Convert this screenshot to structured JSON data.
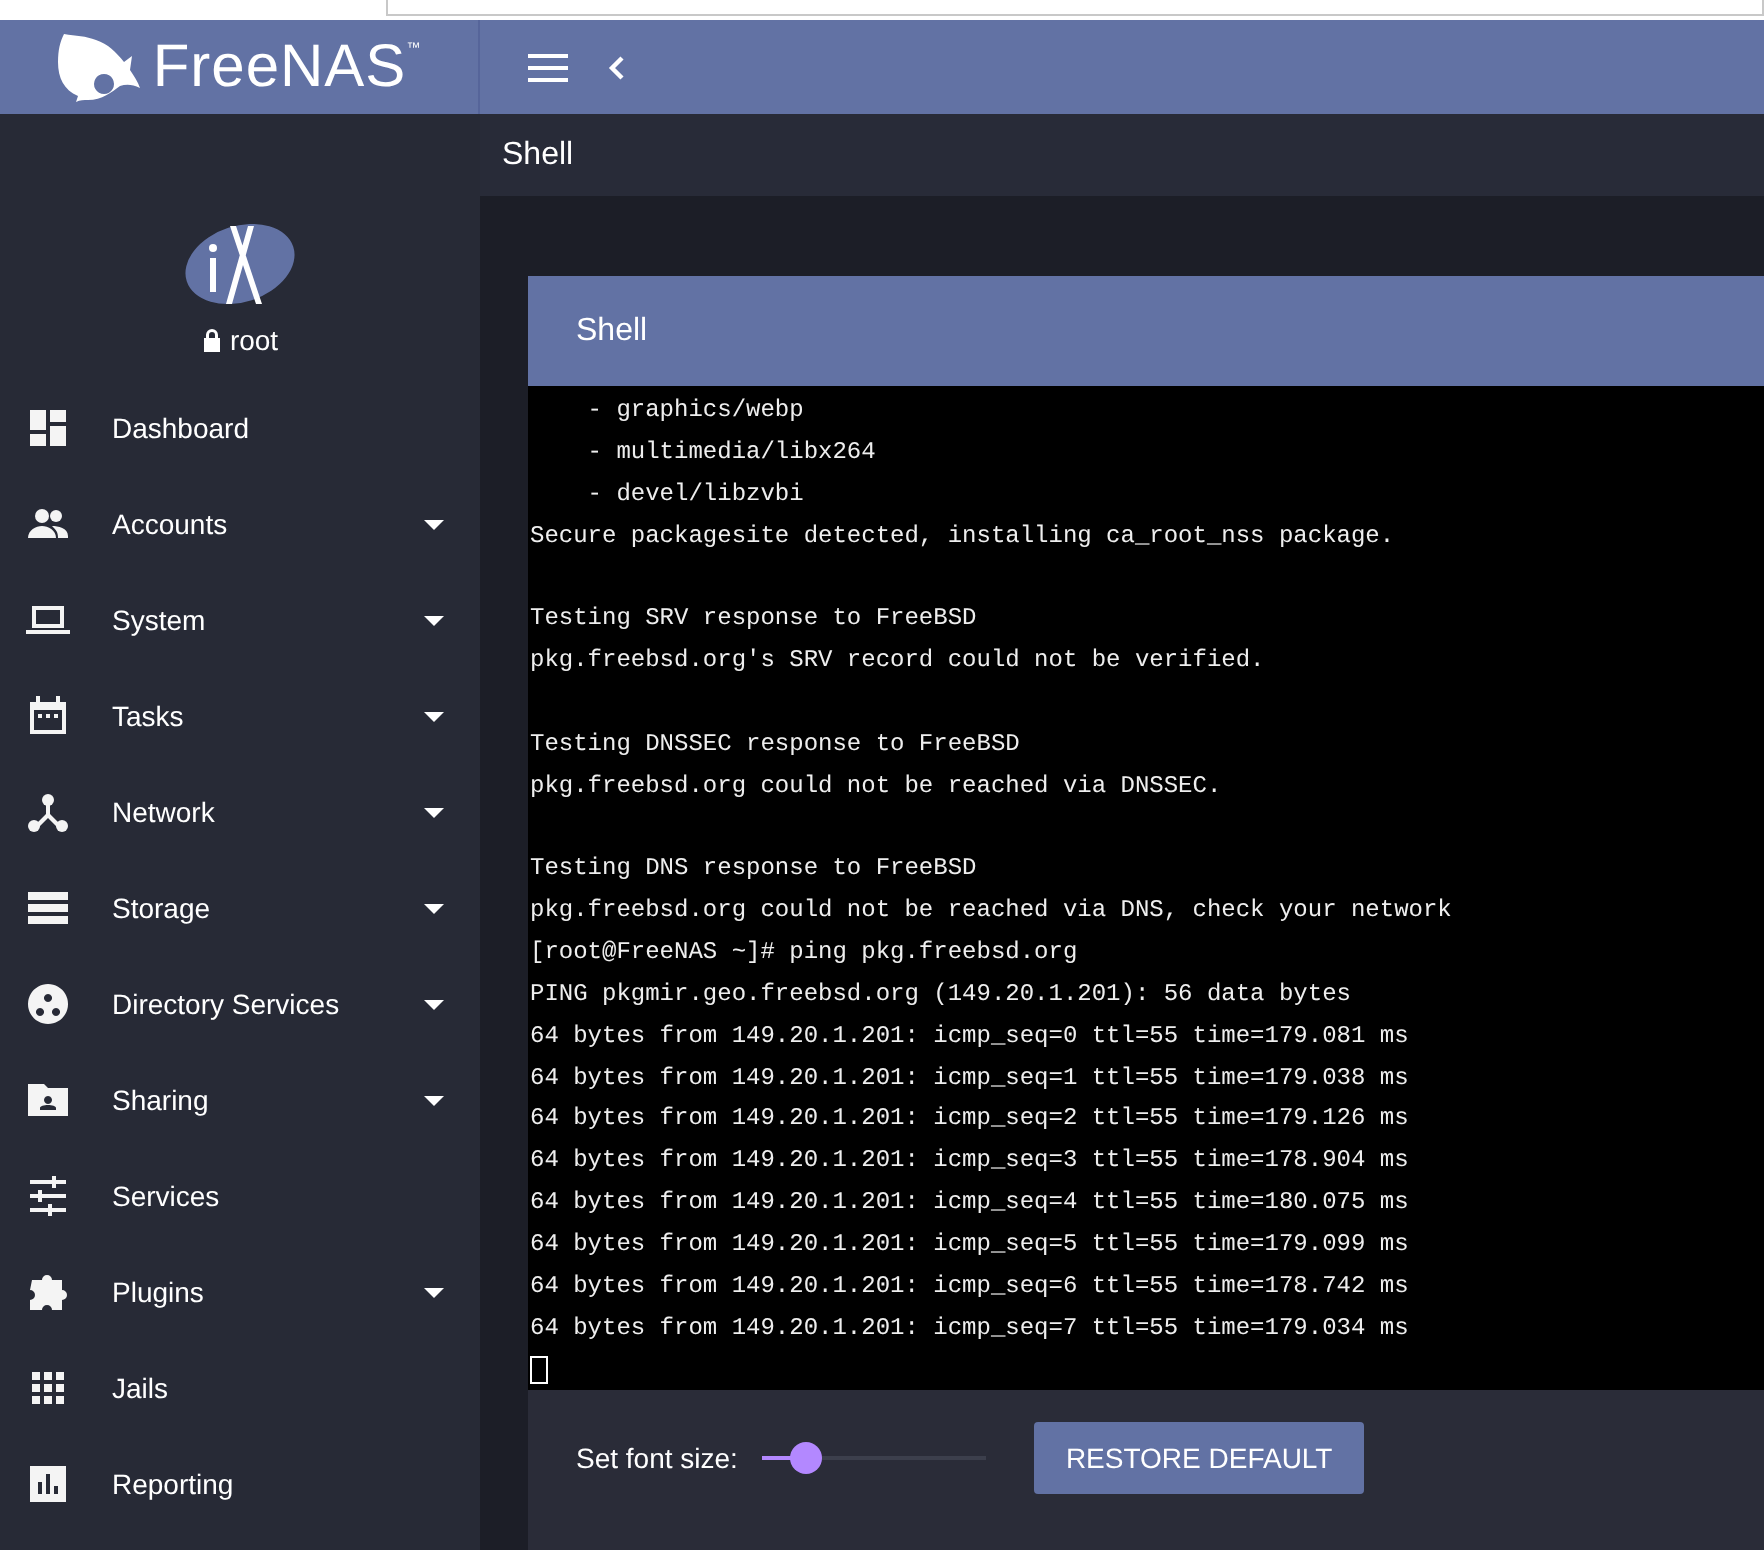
{
  "header": {
    "brand": "FreeNAS",
    "brand_mark": "™"
  },
  "sidebar": {
    "user": "root",
    "items": [
      {
        "label": "Dashboard",
        "expandable": false
      },
      {
        "label": "Accounts",
        "expandable": true
      },
      {
        "label": "System",
        "expandable": true
      },
      {
        "label": "Tasks",
        "expandable": true
      },
      {
        "label": "Network",
        "expandable": true
      },
      {
        "label": "Storage",
        "expandable": true
      },
      {
        "label": "Directory Services",
        "expandable": true
      },
      {
        "label": "Sharing",
        "expandable": true
      },
      {
        "label": "Services",
        "expandable": false
      },
      {
        "label": "Plugins",
        "expandable": true
      },
      {
        "label": "Jails",
        "expandable": false
      },
      {
        "label": "Reporting",
        "expandable": false
      }
    ]
  },
  "page_title": "Shell",
  "card": {
    "title": "Shell",
    "terminal": [
      {
        "kind": "output",
        "text": "    - graphics/webp"
      },
      {
        "kind": "output",
        "text": "    - multimedia/libx264"
      },
      {
        "kind": "output",
        "text": "    - devel/libzvbi"
      },
      {
        "kind": "output",
        "text": "Secure packagesite detected, installing ca_root_nss package."
      },
      {
        "kind": "blank"
      },
      {
        "kind": "output",
        "text": "Testing SRV response to FreeBSD"
      },
      {
        "kind": "output",
        "text": "pkg.freebsd.org's SRV record could not be verified."
      },
      {
        "kind": "blank"
      },
      {
        "kind": "output",
        "text": "Testing DNSSEC response to FreeBSD"
      },
      {
        "kind": "output",
        "text": "pkg.freebsd.org could not be reached via DNSSEC."
      },
      {
        "kind": "blank"
      },
      {
        "kind": "output",
        "text": "Testing DNS response to FreeBSD"
      },
      {
        "kind": "output",
        "text": "pkg.freebsd.org could not be reached via DNS, check your network"
      },
      {
        "kind": "output",
        "text": "[root@FreeNAS ~]# ping pkg.freebsd.org"
      },
      {
        "kind": "output",
        "text": "PING pkgmir.geo.freebsd.org (149.20.1.201): 56 data bytes"
      },
      {
        "kind": "output",
        "text": "64 bytes from 149.20.1.201: icmp_seq=0 ttl=55 time=179.081 ms"
      },
      {
        "kind": "output",
        "text": "64 bytes from 149.20.1.201: icmp_seq=1 ttl=55 time=179.038 ms"
      },
      {
        "kind": "output",
        "text": "64 bytes from 149.20.1.201: icmp_seq=2 ttl=55 time=179.126 ms"
      },
      {
        "kind": "output",
        "text": "64 bytes from 149.20.1.201: icmp_seq=3 ttl=55 time=178.904 ms"
      },
      {
        "kind": "output",
        "text": "64 bytes from 149.20.1.201: icmp_seq=4 ttl=55 time=180.075 ms"
      },
      {
        "kind": "output",
        "text": "64 bytes from 149.20.1.201: icmp_seq=5 ttl=55 time=179.099 ms"
      },
      {
        "kind": "output",
        "text": "64 bytes from 149.20.1.201: icmp_seq=6 ttl=55 time=178.742 ms"
      },
      {
        "kind": "output",
        "text": "64 bytes from 149.20.1.201: icmp_seq=7 ttl=55 time=179.034 ms"
      },
      {
        "kind": "cursor"
      }
    ],
    "font_size": {
      "label": "Set font size:",
      "level": 0.2
    },
    "restore_button": "RESTORE DEFAULT"
  }
}
